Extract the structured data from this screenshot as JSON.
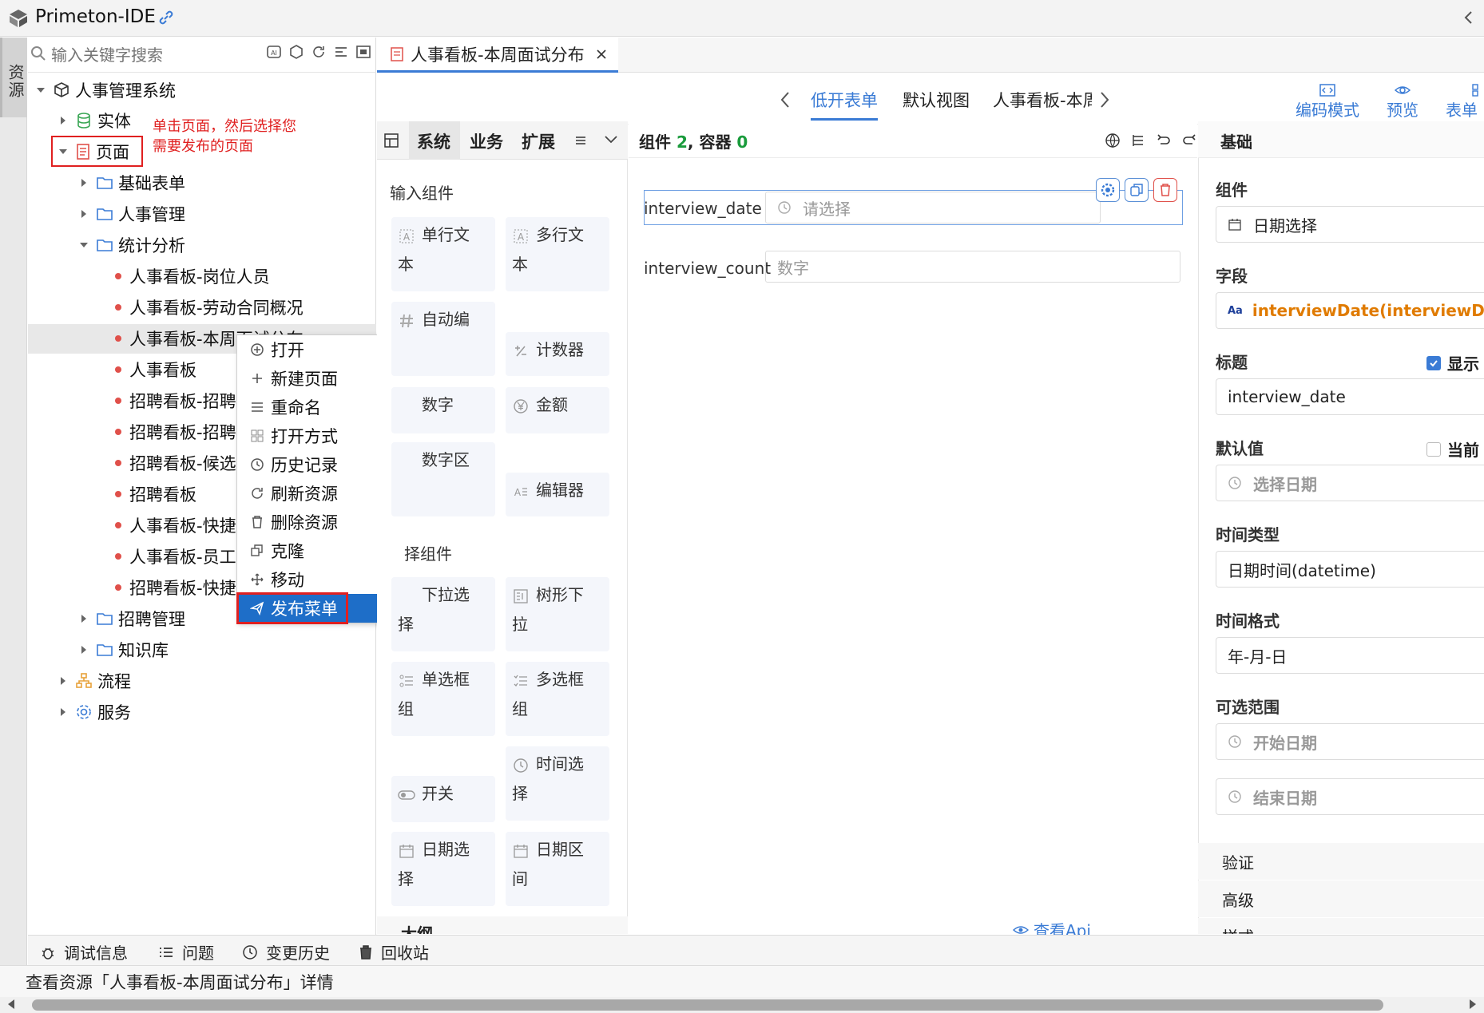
{
  "app": {
    "title": "Primeton-IDE"
  },
  "activity": {
    "resources_tab": "资源"
  },
  "tree": {
    "search_placeholder": "输入关键字搜索",
    "root": "人事管理系统",
    "entity": "实体",
    "page": "页面",
    "annotation_line1": "单击页面，然后选择您",
    "annotation_line2": "需要发布的页面",
    "folders": [
      "基础表单",
      "人事管理",
      "统计分析"
    ],
    "pages": [
      "人事看板-岗位人员",
      "人事看板-劳动合同概况",
      "人事看板-本周面试分布",
      "人事看板",
      "招聘看板-招聘",
      "招聘看板-招聘",
      "招聘看板-候选",
      "招聘看板",
      "人事看板-快捷",
      "人事看板-员工",
      "招聘看板-快捷"
    ],
    "folders_after": [
      "招聘管理",
      "知识库"
    ],
    "process": "流程",
    "service": "服务"
  },
  "context_menu": {
    "items": [
      "打开",
      "新建页面",
      "重命名",
      "打开方式",
      "历史记录",
      "刷新资源",
      "删除资源",
      "克隆",
      "移动",
      "发布菜单"
    ]
  },
  "editor": {
    "tab_title": "人事看板-本周面试分布",
    "view_tabs": [
      "低开表单",
      "默认视图",
      "人事看板-本周"
    ],
    "actions": [
      "编码模式",
      "预览",
      "表单"
    ]
  },
  "palette": {
    "tabs": [
      "系统",
      "业务",
      "扩展"
    ],
    "input_section": "输入组件",
    "select_section": "择组件",
    "input_components": [
      [
        "单行文",
        "本"
      ],
      [
        "多行文",
        "本"
      ],
      [
        "自动编",
        ""
      ],
      [
        "计数器",
        ""
      ],
      [
        "数字",
        ""
      ],
      [
        "金额",
        ""
      ],
      [
        "数字区",
        ""
      ],
      [
        "编辑器",
        ""
      ]
    ],
    "select_components": [
      [
        "下拉选",
        "择"
      ],
      [
        "树形下",
        "拉"
      ],
      [
        "单选框",
        "组"
      ],
      [
        "多选框",
        "组"
      ],
      [
        "开关",
        ""
      ],
      [
        "时间选",
        "择"
      ],
      [
        "日期选",
        "择"
      ],
      [
        "日期区",
        "间"
      ]
    ],
    "outline": "大纲"
  },
  "canvas": {
    "count_prefix": "组件",
    "components": "2",
    "count_mid": ", 容器",
    "containers": "0",
    "fields": [
      {
        "label": "interview_date",
        "placeholder": "请选择"
      },
      {
        "label": "interview_count",
        "placeholder": "数字"
      }
    ],
    "api_link": "查看Api"
  },
  "props": {
    "header": "基础",
    "component_label": "组件",
    "component_value": "日期选择",
    "field_label": "字段",
    "field_value": "interviewDate(interviewDate)",
    "title_label": "标题",
    "show_label": "显示",
    "title_value": "interview_date",
    "default_label": "默认值",
    "current_label": "当前",
    "default_placeholder": "选择日期",
    "time_type_label": "时间类型",
    "time_type_value": "日期时间(datetime)",
    "time_format_label": "时间格式",
    "time_format_value": "年-月-日",
    "range_label": "可选范围",
    "range_start": "开始日期",
    "range_end": "结束日期",
    "sections": [
      "验证",
      "高级",
      "样式"
    ]
  },
  "bottom": {
    "tabs": [
      "调试信息",
      "问题",
      "变更历史",
      "回收站"
    ],
    "status": "查看资源「人事看板-本周面试分布」详情"
  },
  "colors": {
    "accent": "#3a7bd5",
    "annotation": "#e02020",
    "orange": "#e07b00",
    "green": "#1a9b3c"
  }
}
